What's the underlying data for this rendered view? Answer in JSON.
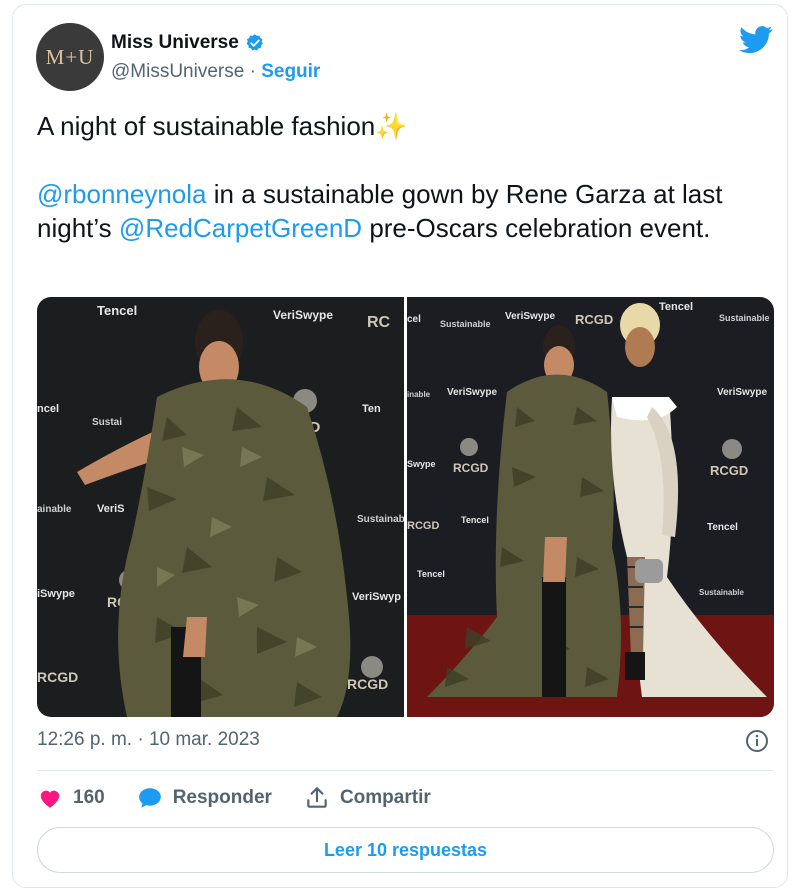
{
  "author": {
    "avatar_text": "M+U",
    "name": "Miss Universe",
    "handle": "@MissUniverse",
    "separator": "·",
    "follow_label": "Seguir"
  },
  "tweet": {
    "line1": "A night of sustainable fashion",
    "line1_emoji": "✨",
    "mention1": "@rbonneynola",
    "text2a": " in a sustainable gown by Rene Garza at last night’s ",
    "mention2": "@RedCarpetGreenD",
    "text2b": " pre-Oscars celebration event."
  },
  "media": {
    "photo1_logos": [
      "Tencel",
      "VeriSwype",
      "RCGD",
      "Sustainable Apparel Coalition"
    ],
    "photo2_logos": [
      "Tencel",
      "VeriSwype",
      "RCGD",
      "Sustainable Apparel Coalition"
    ]
  },
  "meta": {
    "timestamp": "12:26 p. m. · 10 mar. 2023"
  },
  "actions": {
    "likes_count": "160",
    "reply_label": "Responder",
    "share_label": "Compartir"
  },
  "read_replies_label": "Leer 10 respuestas",
  "colors": {
    "accent": "#1d9bf0",
    "like": "#f91880",
    "text": "#0f1419",
    "muted": "#536471"
  },
  "icons": [
    "verified-badge-icon",
    "twitter-bird-icon",
    "info-icon",
    "heart-icon",
    "reply-bubble-icon",
    "share-icon"
  ]
}
